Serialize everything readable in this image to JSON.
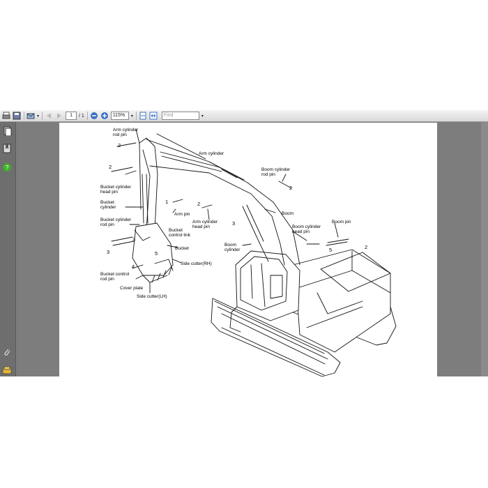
{
  "toolbar": {
    "page_current": "1",
    "page_total": "/ 1",
    "zoom": "115%",
    "find_placeholder": "Find",
    "buttons": [
      "print-icon",
      "save-icon",
      "email-icon",
      "prev-page-icon",
      "next-page-icon",
      "zoom-out-icon",
      "zoom-in-icon",
      "fit-page-icon",
      "fit-width-icon"
    ]
  },
  "left_pane": {
    "icons": [
      "pages-icon",
      "bookmarks-icon",
      "help-icon",
      "attachment-icon",
      "layers-icon"
    ]
  },
  "diagram": {
    "labels": {
      "arm_cylinder_rod_pin": [
        "Arm cylinder",
        "rod pin"
      ],
      "arm_cylinder": "Arm cylinder",
      "boom_cylinder_rod_pin": [
        "Boom cylinder",
        "rod pin"
      ],
      "bucket_cylinder_head_pin": [
        "Bucket cylinder",
        "head pin"
      ],
      "bucket_cylinder": [
        "Bucket",
        "cylinder"
      ],
      "arm_pin": "Arm pin",
      "arm_cylinder_head_pin": [
        "Arm cylinder",
        "head pin"
      ],
      "boom": "Boom",
      "bucket_cylinder_rod_pin": [
        "Bucket cylinder",
        "rod pin"
      ],
      "bucket_control_link": [
        "Bucket",
        "control link"
      ],
      "boom_cylinder_head_pin": [
        "Boom cylinder",
        "head pin"
      ],
      "boom_pin": "Boom pin",
      "boom_cylinder": [
        "Boom",
        "cylinder"
      ],
      "bucket": "Bucket",
      "side_cutter_rh": "Side cutter(RH)",
      "bucket_control_rod_pin": [
        "Bucket control",
        "rod pin"
      ],
      "cover_plate": "Cover plate",
      "side_cutter_lh": "Side cutter(LH)"
    },
    "callouts": [
      "2",
      "2",
      "1",
      "2",
      "3",
      "3",
      "3",
      "4",
      "5",
      "2",
      "5",
      "2"
    ]
  }
}
